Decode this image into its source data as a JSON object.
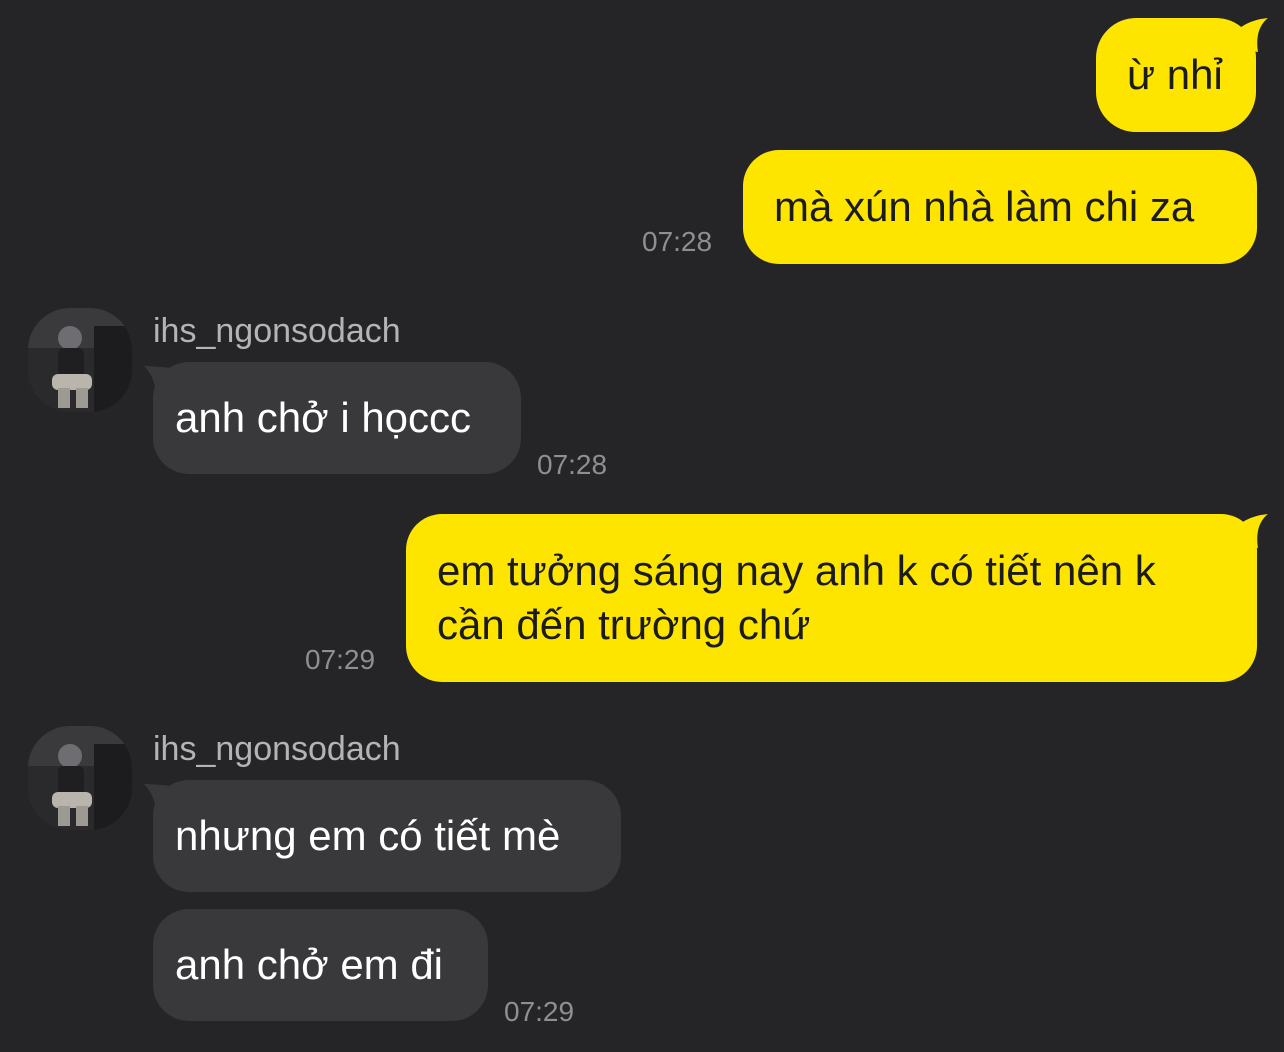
{
  "messages": [
    {
      "direction": "outgoing",
      "text": "ừ nhỉ",
      "time": ""
    },
    {
      "direction": "outgoing",
      "text": "mà xún nhà làm chi za",
      "time": "07:28"
    },
    {
      "direction": "incoming",
      "sender": "ihs_ngonsodach",
      "text": "anh chở i họccc",
      "time": "07:28"
    },
    {
      "direction": "outgoing",
      "lines": [
        "em tưởng sáng nay anh k có tiết nên k",
        "cần đến trường chứ"
      ],
      "time": "07:29"
    },
    {
      "direction": "incoming",
      "sender": "ihs_ngonsodach",
      "text": "nhưng em có tiết mè",
      "time": ""
    },
    {
      "direction": "incoming",
      "text": "anh chở em đi",
      "time": "07:29"
    }
  ],
  "colors": {
    "background": "#252527",
    "outgoing_bubble": "#fee500",
    "incoming_bubble": "#39393c",
    "timestamp": "#8e8e93",
    "sender_name": "#b4b4b8"
  },
  "icons": {
    "avatar": "user-avatar-photo"
  }
}
